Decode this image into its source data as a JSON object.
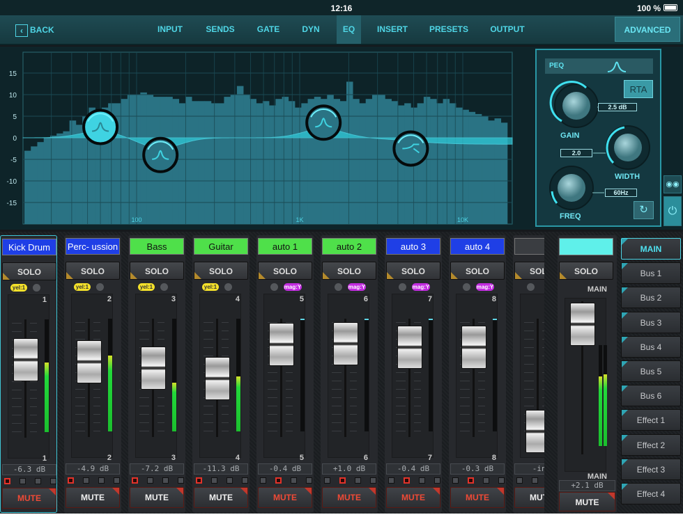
{
  "status": {
    "time": "12:16",
    "battery": "100 %",
    "battery_level": 1.0
  },
  "nav": {
    "back": "BACK",
    "tabs": [
      "INPUT",
      "SENDS",
      "GATE",
      "DYN",
      "EQ",
      "INSERT",
      "PRESETS",
      "OUTPUT"
    ],
    "active_tab": "EQ",
    "advanced": "ADVANCED"
  },
  "eq": {
    "y_ticks": [
      "15",
      "10",
      "5",
      "0",
      "-5",
      "-10",
      "-15"
    ],
    "x_ticks": [
      "100",
      "1K",
      "10K"
    ],
    "rta_db": [
      -3,
      -2,
      -1,
      0,
      0.5,
      1,
      1.5,
      4,
      3,
      5,
      7,
      6.5,
      7,
      8,
      8,
      9,
      10,
      10,
      10.5,
      10,
      9.5,
      9.5,
      9.5,
      9,
      8,
      9.5,
      8.5,
      8.5,
      8.5,
      8,
      8,
      9.5,
      10,
      12,
      10,
      9,
      8,
      8.5,
      7.5,
      9,
      9.5,
      8.5,
      7,
      8,
      9,
      9.5,
      9,
      10,
      9,
      8.5,
      13,
      9,
      8,
      9,
      10,
      10,
      9,
      8.5,
      7.5,
      8,
      7,
      8,
      9.5,
      9,
      8,
      9,
      8,
      7,
      6.5,
      6,
      5.5,
      5,
      4,
      4.5,
      3.5
    ],
    "bands": [
      {
        "type": "peak",
        "freq_hz": 60,
        "gain_db": 2.5,
        "selected": true
      },
      {
        "type": "peak",
        "freq_hz": 140,
        "gain_db": -4,
        "selected": false
      },
      {
        "type": "peak",
        "freq_hz": 1400,
        "gain_db": 3.5,
        "selected": false
      },
      {
        "type": "shelf",
        "freq_hz": 4800,
        "gain_db": -2.5,
        "selected": false
      }
    ],
    "panel": {
      "filter_label": "PEQ",
      "rta": "RTA",
      "gain_label": "GAIN",
      "gain_value": "2.5 dB",
      "width_label": "WIDTH",
      "width_value": "2.0",
      "freq_label": "FREQ",
      "freq_value": "60Hz"
    }
  },
  "channels": [
    {
      "name": "Kick Drum",
      "color": "#1f3fe6",
      "text_color": "#ffffff",
      "selected": true,
      "dots": [
        "yel:1",
        "off"
      ],
      "num": "1",
      "fader": 0.64,
      "meter": 0.62,
      "db": "-6.3 dB",
      "routes": [
        1,
        0,
        0,
        0
      ],
      "mute": true
    },
    {
      "name": "Perc- ussion",
      "color": "#1f3fe6",
      "text_color": "#ffffff",
      "dots": [
        "yel:1",
        "off"
      ],
      "num": "2",
      "fader": 0.62,
      "meter": 0.67,
      "db": "-4.9 dB",
      "routes": [
        1,
        0,
        0,
        0
      ],
      "mute": false
    },
    {
      "name": "Bass",
      "color": "#4fe04a",
      "text_color": "#111111",
      "dots": [
        "yel:1",
        "off"
      ],
      "num": "3",
      "fader": 0.56,
      "meter": 0.43,
      "db": "-7.2 dB",
      "routes": [
        1,
        0,
        0,
        0
      ],
      "mute": false
    },
    {
      "name": "Guitar",
      "color": "#4fe04a",
      "text_color": "#111111",
      "dots": [
        "yel:1",
        "off"
      ],
      "num": "4",
      "fader": 0.47,
      "meter": 0.49,
      "db": "-11.3 dB",
      "routes": [
        1,
        0,
        0,
        0
      ],
      "mute": false
    },
    {
      "name": "auto 1",
      "color": "#4fe04a",
      "text_color": "#111111",
      "dots": [
        "off",
        "mag:Y"
      ],
      "num": "5",
      "fader": 0.77,
      "meter": 0,
      "db": "-0.4 dB",
      "routes": [
        0,
        1,
        0,
        0
      ],
      "mute": true
    },
    {
      "name": "auto 2",
      "color": "#4fe04a",
      "text_color": "#111111",
      "dots": [
        "off",
        "mag:Y"
      ],
      "num": "6",
      "fader": 0.78,
      "meter": 0,
      "db": "+1.0 dB",
      "routes": [
        0,
        1,
        0,
        0
      ],
      "mute": true
    },
    {
      "name": "auto 3",
      "color": "#1f3fe6",
      "text_color": "#ffffff",
      "dots": [
        "off",
        "mag:Y"
      ],
      "num": "7",
      "fader": 0.75,
      "meter": 0,
      "db": "-0.4 dB",
      "routes": [
        0,
        1,
        0,
        0
      ],
      "mute": true
    },
    {
      "name": "auto 4",
      "color": "#1f3fe6",
      "text_color": "#ffffff",
      "dots": [
        "off",
        "mag:Y"
      ],
      "num": "8",
      "fader": 0.75,
      "meter": 0,
      "db": "-0.3 dB",
      "routes": [
        0,
        1,
        0,
        0
      ],
      "mute": true
    },
    {
      "name": "",
      "color": "#3a3d41",
      "text_color": "#ffffff",
      "dots": [
        "off"
      ],
      "num": "",
      "fader": 0,
      "meter": 0,
      "db": "-inf",
      "routes": [
        0,
        0,
        0,
        0
      ],
      "mute": false
    }
  ],
  "labels": {
    "solo": "SOLO",
    "mute": "MUTE"
  },
  "main_strip": {
    "name": "",
    "color": "#5ff0ea",
    "top_label": "MAIN",
    "bottom_label": "MAIN",
    "fader": 0.86,
    "meter": [
      0.69,
      0.71
    ],
    "db": "+2.1 dB",
    "mute": false
  },
  "buses": [
    {
      "label": "MAIN",
      "active": true
    },
    {
      "label": "Bus 1"
    },
    {
      "label": "Bus 2"
    },
    {
      "label": "Bus 3"
    },
    {
      "label": "Bus 4"
    },
    {
      "label": "Bus 5"
    },
    {
      "label": "Bus 6"
    },
    {
      "label": "Effect 1"
    },
    {
      "label": "Effect 2"
    },
    {
      "label": "Effect 3"
    },
    {
      "label": "Effect 4"
    }
  ]
}
